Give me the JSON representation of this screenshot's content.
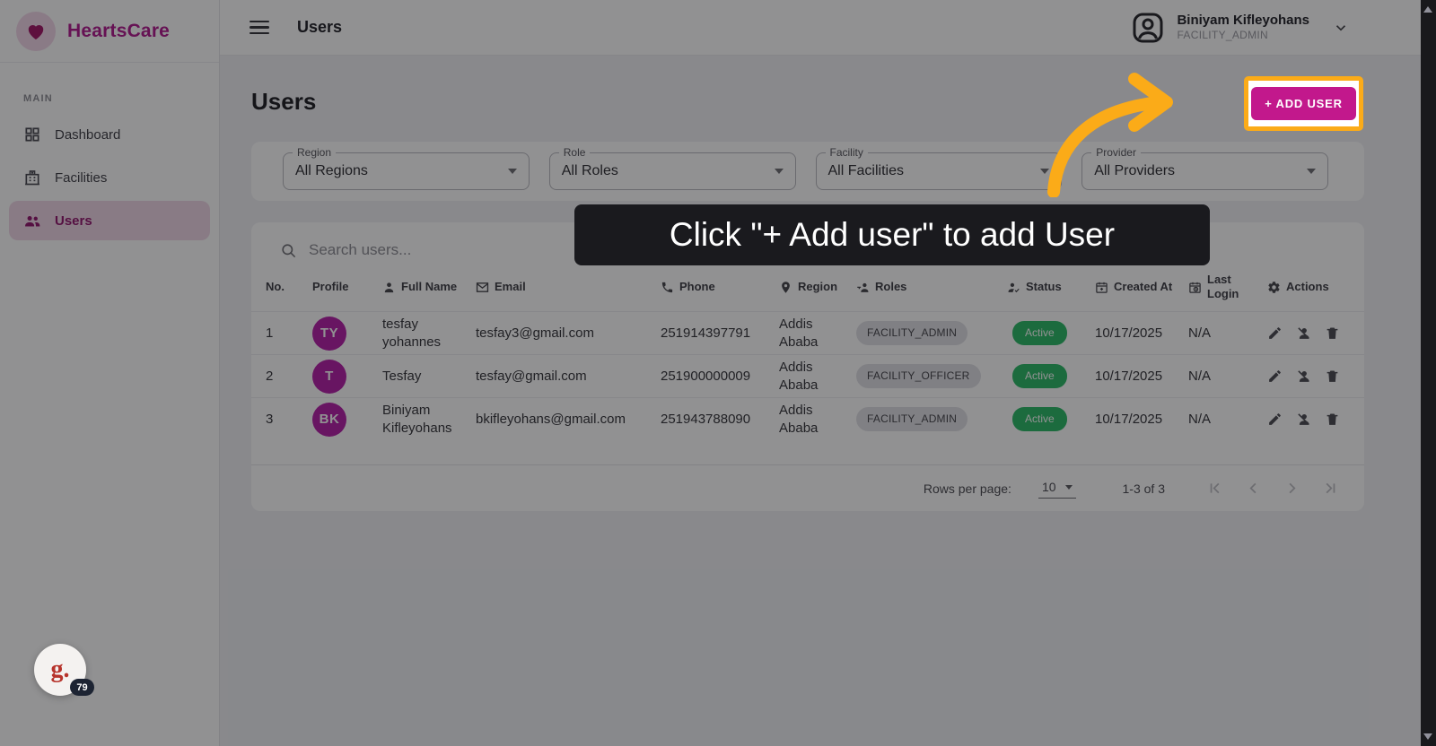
{
  "brand": {
    "name": "HeartsCare"
  },
  "sidebar": {
    "section_label": "MAIN",
    "items": [
      {
        "label": "Dashboard"
      },
      {
        "label": "Facilities"
      },
      {
        "label": "Users"
      }
    ]
  },
  "topbar": {
    "title": "Users",
    "user": {
      "name": "Biniyam Kifleyohans",
      "role": "FACILITY_ADMIN"
    }
  },
  "page": {
    "title": "Users",
    "add_user_label": "+ ADD USER"
  },
  "filters": [
    {
      "label": "Region",
      "value": "All Regions"
    },
    {
      "label": "Role",
      "value": "All Roles"
    },
    {
      "label": "Facility",
      "value": "All Facilities"
    },
    {
      "label": "Provider",
      "value": "All Providers"
    }
  ],
  "tutorial": {
    "tooltip": "Click \"+ Add user\" to add User"
  },
  "search": {
    "placeholder": "Search users..."
  },
  "table": {
    "columns": [
      "No.",
      "Profile",
      "Full Name",
      "Email",
      "Phone",
      "Region",
      "Roles",
      "Status",
      "Created At",
      "Last Login",
      "Actions"
    ],
    "rows": [
      {
        "no": "1",
        "initials": "TY",
        "full_name": "tesfay yohannes",
        "email": "tesfay3@gmail.com",
        "phone": "251914397791",
        "region": "Addis Ababa",
        "role_chip": "FACILITY_ADMIN",
        "status": "Active",
        "created_at": "10/17/2025",
        "last_login": "N/A"
      },
      {
        "no": "2",
        "initials": "T",
        "full_name": "Tesfay",
        "email": "tesfay@gmail.com",
        "phone": "251900000009",
        "region": "Addis Ababa",
        "role_chip": "FACILITY_OFFICER",
        "status": "Active",
        "created_at": "10/17/2025",
        "last_login": "N/A"
      },
      {
        "no": "3",
        "initials": "BK",
        "full_name": "Biniyam Kifleyohans",
        "email": "bkifleyohans@gmail.com",
        "phone": "251943788090",
        "region": "Addis Ababa",
        "role_chip": "FACILITY_ADMIN",
        "status": "Active",
        "created_at": "10/17/2025",
        "last_login": "N/A"
      }
    ]
  },
  "pagination": {
    "rows_per_page_label": "Rows per page:",
    "rows_per_page": "10",
    "range": "1-3 of 3"
  },
  "widget": {
    "label": "g.",
    "badge": "79"
  },
  "colors": {
    "brand_magenta": "#C2188C",
    "highlight_orange": "#FBAB18",
    "active_green": "#2BBB66",
    "avatar_purple": "#B51EA8",
    "sidebar_active_bg": "#F0D8E8",
    "tooltip_bg": "#1A1A1E"
  }
}
